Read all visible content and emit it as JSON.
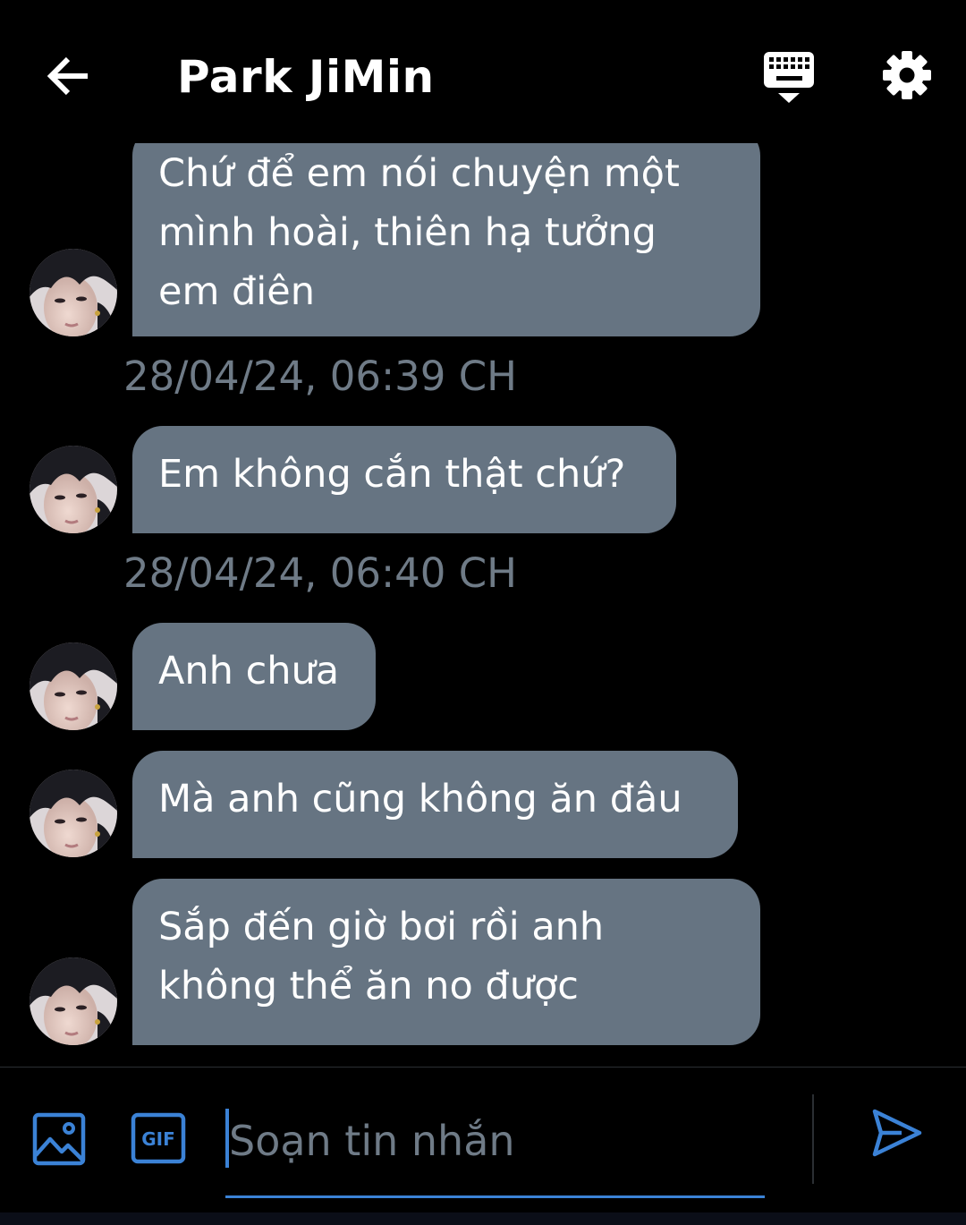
{
  "header": {
    "title": "Park JiMin",
    "back_icon": "arrow-left-icon",
    "keyboard_icon": "keyboard-hide-icon",
    "settings_icon": "gear-icon"
  },
  "conversation": {
    "messages": [
      {
        "text": "Chứ để em nói chuyện một\nmình hoài, thiên hạ tưởng\nem điên"
      },
      {
        "text": "Em không cắn thật chứ?"
      },
      {
        "text": "Anh chưa"
      },
      {
        "text": "Mà anh cũng không ăn đâu"
      },
      {
        "text": "Sắp đến giờ bơi rồi anh\nkhông thể ăn no được"
      }
    ],
    "timestamps": [
      "28/04/24, 06:39 CH",
      "28/04/24, 06:40 CH"
    ]
  },
  "composer": {
    "placeholder": "Soạn tin nhắn",
    "value": "",
    "image_icon": "image-icon",
    "gif_icon": "gif-icon",
    "send_icon": "send-icon"
  },
  "colors": {
    "background": "#000000",
    "bubble": "#667482",
    "timestamp": "#6f7b87",
    "accent": "#3b82d6"
  }
}
